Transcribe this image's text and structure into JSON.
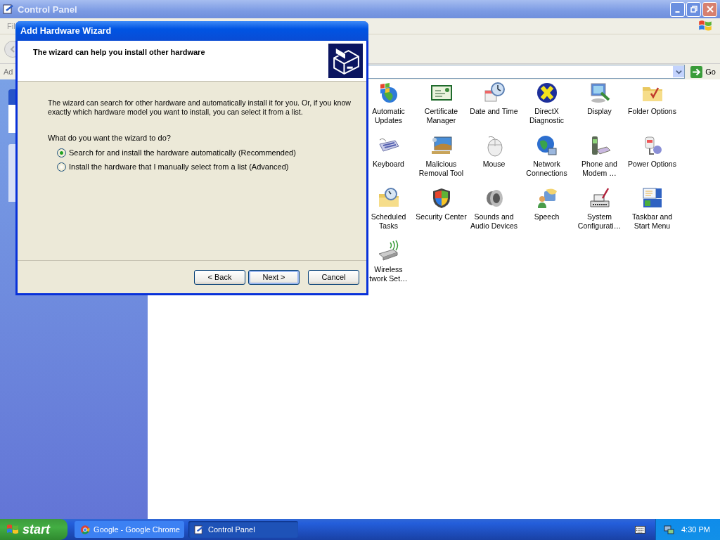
{
  "window": {
    "title": "Control Panel",
    "menu_partial": "Fil",
    "address_partial": "Ad",
    "go": "Go"
  },
  "items": [
    {
      "label": "Automatic Updates"
    },
    {
      "label": "Certificate Manager"
    },
    {
      "label": "Date and Time"
    },
    {
      "label": "DirectX Diagnostic"
    },
    {
      "label": "Display"
    },
    {
      "label": "Folder Options"
    },
    {
      "label": "Keyboard"
    },
    {
      "label": "Malicious Removal Tool"
    },
    {
      "label": "Mouse"
    },
    {
      "label": "Network Connections"
    },
    {
      "label": "Phone and Modem …"
    },
    {
      "label": "Power Options"
    },
    {
      "label": "Scheduled Tasks"
    },
    {
      "label": "Security Center"
    },
    {
      "label": "Sounds and Audio Devices"
    },
    {
      "label": "Speech"
    },
    {
      "label": "System Configurati…"
    },
    {
      "label": "Taskbar and Start Menu"
    },
    {
      "label": "Wireless\ntwork Set…"
    }
  ],
  "dialog": {
    "title": "Add Hardware Wizard",
    "heading": "The wizard can help you install other hardware",
    "description": "The wizard can search for other hardware and automatically install it for you. Or, if you know exactly which hardware model you want to install, you can select it from a list.",
    "question": "What do you want the wizard to do?",
    "options": [
      {
        "label": "Search for and install the hardware automatically (Recommended)",
        "selected": true
      },
      {
        "label": "Install the hardware that I manually select from a list (Advanced)",
        "selected": false
      }
    ],
    "buttons": [
      {
        "label": "< Back",
        "default": false
      },
      {
        "label": "Next >",
        "default": true
      },
      {
        "label": "Cancel",
        "default": false
      }
    ]
  },
  "taskbar": {
    "start": "start",
    "tasks": [
      {
        "label": "Google - Google Chrome",
        "selected": false
      },
      {
        "label": "Control Panel",
        "selected": true
      }
    ],
    "clock": "4:30 PM"
  }
}
